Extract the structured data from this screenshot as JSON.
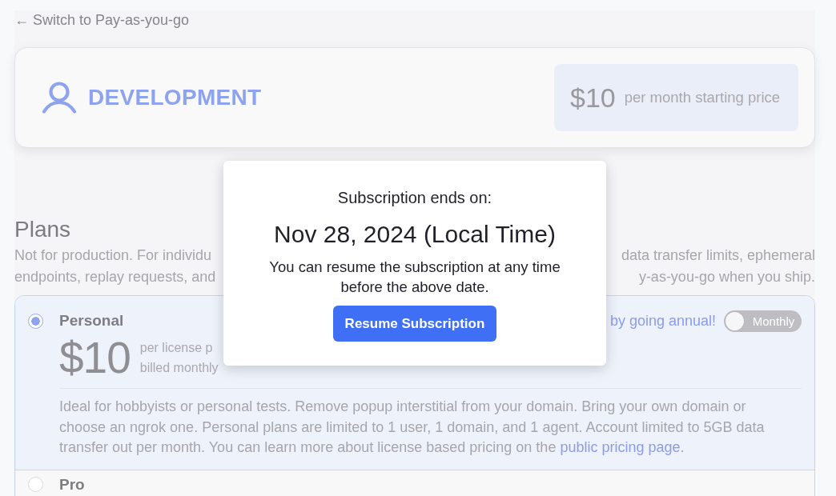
{
  "back_link": "← Switch to Pay-as-you-go",
  "plan_header": {
    "name": "DEVELOPMENT",
    "price": "$10",
    "price_note": "per month starting price"
  },
  "plans_section": {
    "title": "Plans",
    "description_lines": [
      {
        "left": "Not for production. For individu",
        "right": "data transfer limits, ephemeral"
      },
      {
        "left": "endpoints, replay requests, and",
        "right": "y-as-you-go when you ship."
      }
    ]
  },
  "plans": [
    {
      "name": "Personal",
      "selected": true,
      "price": "$10",
      "price_note_lines": [
        "per license p",
        "billed monthly"
      ],
      "annual_promo": "by going annual!",
      "billing_toggle": {
        "label": "Monthly",
        "on": false
      },
      "description": "Ideal for hobbyists or personal tests. Remove popup interstitial from your domain. Bring your own domain or choose an ngrok one. Personal plans are limited to 1 user, 1 domain, and 1 agent. Account limited to 5GB data transfer out per month. You can learn more about license based pricing on the ",
      "link": "public pricing page",
      "description_end": "."
    },
    {
      "name": "Pro",
      "selected": false
    }
  ],
  "modal": {
    "heading": "Subscription ends on:",
    "date": "Nov 28, 2024 (Local Time)",
    "message": "You can resume the subscription at any time before the above date.",
    "button": "Resume Subscription"
  }
}
